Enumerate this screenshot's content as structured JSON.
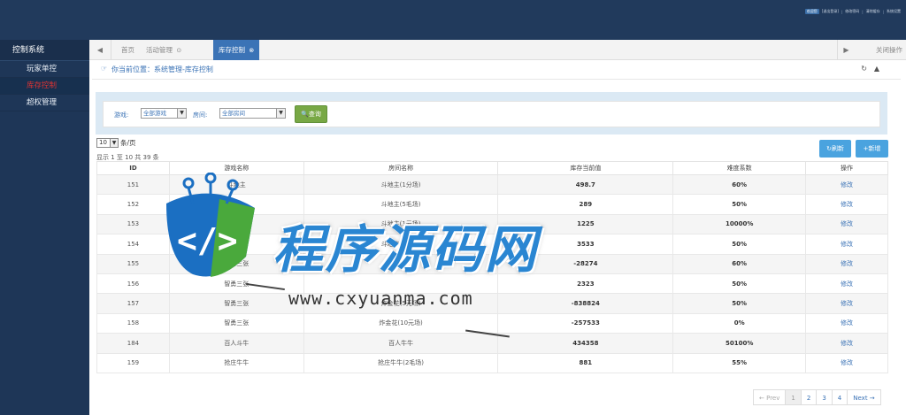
{
  "header": {
    "links": [
      "欢迎您",
      "[退出登录]",
      "修改密码",
      "清除缓存",
      "系统设置"
    ]
  },
  "sidebar": {
    "title": "控制系统",
    "items": [
      {
        "label": "玩家单控"
      },
      {
        "label": "库存控制",
        "active": true
      },
      {
        "label": "超权管理"
      }
    ]
  },
  "tabs": {
    "prev_icon": "◀",
    "items": [
      {
        "label": "首页"
      },
      {
        "label": "活动管理",
        "close": "⊙"
      },
      {
        "label": "库存控制",
        "close": "⊗",
        "active": true
      }
    ],
    "next_icon": "▶",
    "close_ops": "关闭操作"
  },
  "breadcrumb": {
    "icon": "☞",
    "text": "你当前位置：系统管理-库存控制"
  },
  "filter": {
    "game_label": "游戏:",
    "game_value": "全部游戏",
    "room_label": "房间:",
    "room_value": "全部房间",
    "query_label": "查询"
  },
  "list": {
    "page_size": "10",
    "page_size_suffix": "条/页",
    "info": "显示 1 至 10 共 39 条",
    "refresh_label": "刷新",
    "add_label": "+新增",
    "columns": [
      "ID",
      "游戏名称",
      "房间名称",
      "库存当前值",
      "难度系数",
      "操作"
    ],
    "rows": [
      {
        "id": "151",
        "game": "斗地主",
        "room": "斗地主(1分场)",
        "stock": "498.7",
        "diff": "60%",
        "op": "修改"
      },
      {
        "id": "152",
        "game": "",
        "room": "斗地主(5毛场)",
        "stock": "289",
        "diff": "50%",
        "op": "修改"
      },
      {
        "id": "153",
        "game": "",
        "room": "斗地主(1元场)",
        "stock": "1225",
        "diff": "10000%",
        "op": "修改"
      },
      {
        "id": "154",
        "game": "",
        "room": "斗地主(5元场)",
        "stock": "3533",
        "diff": "50%",
        "op": "修改"
      },
      {
        "id": "155",
        "game": "智勇三张",
        "room": "",
        "stock": "-28274",
        "diff": "60%",
        "op": "修改"
      },
      {
        "id": "156",
        "game": "智勇三张",
        "room": "",
        "stock": "2323",
        "diff": "50%",
        "op": "修改"
      },
      {
        "id": "157",
        "game": "智勇三张",
        "room": "炸金花(5元场)",
        "stock": "-838824",
        "diff": "50%",
        "op": "修改"
      },
      {
        "id": "158",
        "game": "智勇三张",
        "room": "炸金花(10元场)",
        "stock": "-257533",
        "diff": "0%",
        "op": "修改"
      },
      {
        "id": "184",
        "game": "百人斗牛",
        "room": "百人牛牛",
        "stock": "434358",
        "diff": "50100%",
        "op": "修改"
      },
      {
        "id": "159",
        "game": "抢庄牛牛",
        "room": "抢庄牛牛(2毛场)",
        "stock": "881",
        "diff": "55%",
        "op": "修改"
      }
    ]
  },
  "pager": {
    "prev": "← Prev",
    "pages": [
      "1",
      "2",
      "3",
      "4"
    ],
    "next": "Next →"
  },
  "watermark": {
    "text": "程序源码网",
    "url": "www.cxyuanma.com"
  },
  "colors": {
    "topbar": "#213a5c",
    "sidebar": "#1e3657",
    "accent": "#3b73b6",
    "query": "#78a845",
    "action": "#4aa3df"
  }
}
